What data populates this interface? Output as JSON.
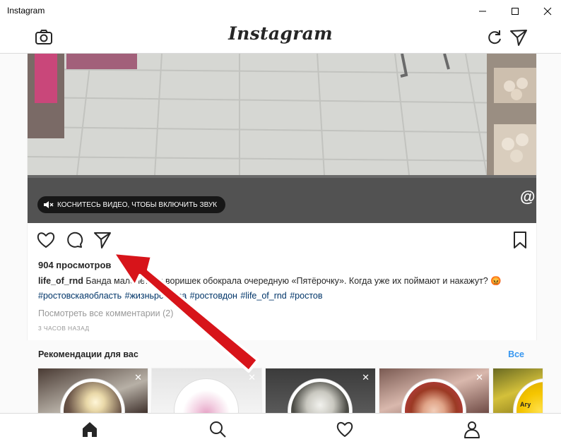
{
  "window": {
    "title": "Instagram"
  },
  "header": {
    "logo": "Instagram"
  },
  "post": {
    "sound_hint": "КОСНИТЕСЬ ВИДЕО, ЧТОБЫ ВКЛЮЧИТЬ ЗВУК",
    "watermark": "@",
    "views": "904 просмотров",
    "username": "life_of_rnd",
    "caption": "Банда малолетних воришек обокрала очередную «Пятёрочку». Когда уже их поймают и накажут? 😡",
    "hashtags": "#ростовскаяобласть #жизньростова #ростовдон #life_of_rnd #ростов",
    "view_comments": "Посмотреть все комментарии (2)",
    "timestamp": "3 ЧАСОВ НАЗАД"
  },
  "recommendations": {
    "title": "Рекомендации для вас",
    "see_all": "Все",
    "close_glyph": "✕",
    "partial_text": "Агу"
  },
  "colors": {
    "link": "#003569",
    "accent": "#3897f0",
    "arrow": "#d7141a"
  },
  "icons": [
    "camera-icon",
    "refresh-icon",
    "direct-icon",
    "heart-icon",
    "comment-icon",
    "share-icon",
    "bookmark-icon",
    "home-icon",
    "search-icon",
    "activity-icon",
    "profile-icon"
  ]
}
